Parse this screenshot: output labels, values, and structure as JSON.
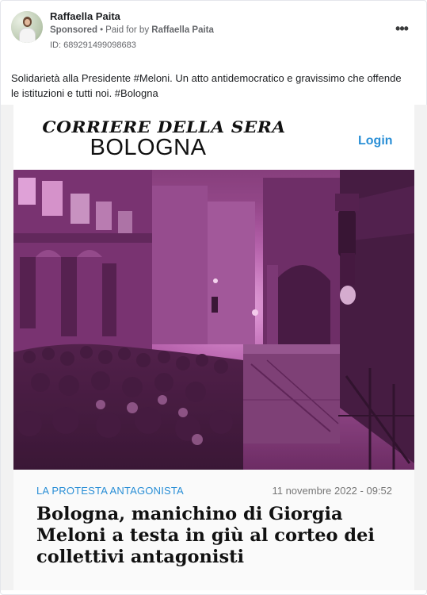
{
  "post": {
    "author": "Raffaella Paita",
    "sponsored": "Sponsored",
    "separator": "•",
    "paid_for_prefix": "Paid for by",
    "payer": "Raffaella Paita",
    "ad_id": "ID: 689291499098683",
    "more_icon": "more-horizontal-icon",
    "text": "Solidarietà alla Presidente #Meloni. Un atto antidemocratico e gravissimo che offende le istituzioni e tutti noi. #Bologna"
  },
  "creative": {
    "masthead": "CORRIERE DELLA SERA",
    "city": "BOLOGNA",
    "login": "Login",
    "section": "LA PROTESTA ANTAGONISTA",
    "date": "11 novembre 2022 - 09:52",
    "headline": "Bologna, manichino di Giorgia Meloni a testa in giù al corteo dei collettivi antagonisti",
    "link_color": "#2a8fd6",
    "tint_color": "#c455b8"
  }
}
